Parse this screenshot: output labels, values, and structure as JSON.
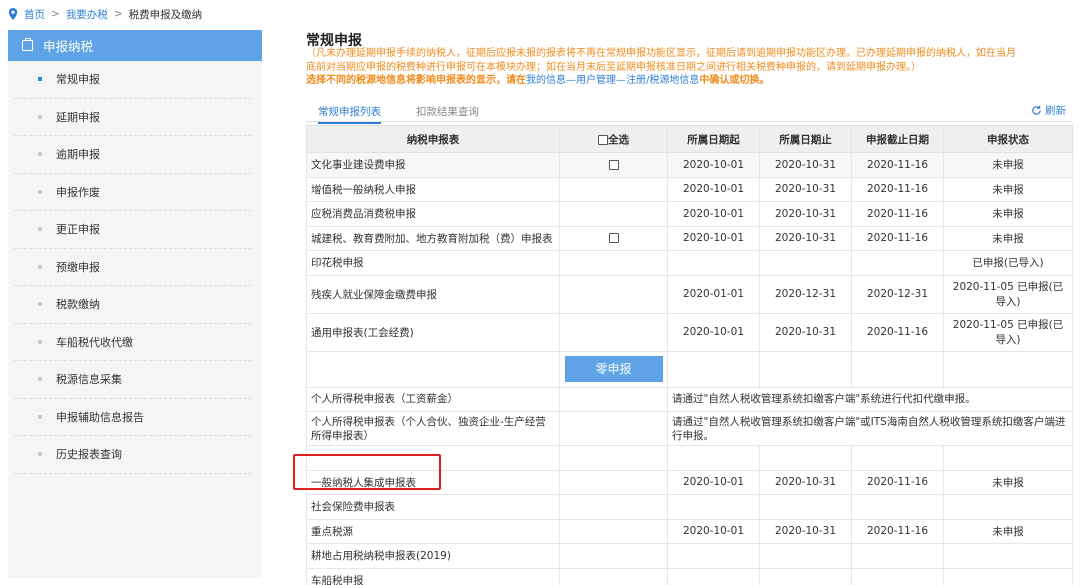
{
  "breadcrumb": {
    "home": "首页",
    "sep": ">",
    "l2": "我要办税",
    "current": "税费申报及缴纳"
  },
  "sidebar": {
    "header": "申报纳税",
    "items": [
      {
        "label": "常规申报",
        "active": true
      },
      {
        "label": "延期申报"
      },
      {
        "label": "逾期申报"
      },
      {
        "label": "申报作废"
      },
      {
        "label": "更正申报"
      },
      {
        "label": "预缴申报"
      },
      {
        "label": "税款缴纳"
      },
      {
        "label": "车船税代收代缴"
      },
      {
        "label": "税源信息采集"
      },
      {
        "label": "申报辅助信息报告"
      },
      {
        "label": "历史报表查询"
      }
    ]
  },
  "main": {
    "title": "常规申报",
    "notice_line1": "（凡未办理延期申报手续的纳税人，征期后应报未报的报表将不再在常规申报功能区显示，征期后请到逾期申报功能区办理。已办理延期申报的纳税人，如在当月",
    "notice_line2": "底前对当期应申报的税费种进行申报可在本模块办理；如在当月末后至延期申报核准日期之间进行相关税费种申报的，请到延期申报办理。）",
    "notice3_a": "选择不同的税源地信息将影响申报表的显示，请在",
    "notice3_link": "我的信息—用户管理—注册/税源地信息",
    "notice3_b": "中确认或切换。",
    "tabs": [
      "常规申报列表",
      "扣款结果查询"
    ],
    "refresh": "刷新"
  },
  "table": {
    "headers": [
      "纳税申报表",
      "全选",
      "所属日期起",
      "所属日期止",
      "申报截止日期",
      "申报状态"
    ],
    "rows": [
      {
        "name": "文化事业建设费申报",
        "cb": true,
        "start": "2020-10-01",
        "end": "2020-10-31",
        "deadline": "2020-11-16",
        "status": "未申报",
        "gray": true
      },
      {
        "name": "增值税一般纳税人申报",
        "start": "2020-10-01",
        "end": "2020-10-31",
        "deadline": "2020-11-16",
        "status": "未申报"
      },
      {
        "name": "应税消费品消费税申报",
        "start": "2020-10-01",
        "end": "2020-10-31",
        "deadline": "2020-11-16",
        "status": "未申报"
      },
      {
        "name": "城建税、教育费附加、地方教育附加税（费）申报表",
        "cb": true,
        "start": "2020-10-01",
        "end": "2020-10-31",
        "deadline": "2020-11-16",
        "status": "未申报"
      },
      {
        "name": "印花税申报",
        "status": "已申报(已导入)"
      },
      {
        "name": "残疾人就业保障金缴费申报",
        "start": "2020-01-01",
        "end": "2020-12-31",
        "deadline": "2020-12-31",
        "status": "2020-11-05 已申报(已导入)"
      },
      {
        "name": "通用申报表(工会经费)",
        "start": "2020-10-01",
        "end": "2020-10-31",
        "deadline": "2020-11-16",
        "status": "2020-11-05 已申报(已导入)"
      }
    ],
    "zero_button": "零申报",
    "rows2": [
      {
        "name": "个人所得税申报表（工资薪金）",
        "note": "请通过\"自然人税收管理系统扣缴客户端\"系统进行代扣代缴申报。"
      },
      {
        "name": "个人所得税申报表（个人合伙、独资企业-生产经营所得申报表）",
        "note": "请通过\"自然人税收管理系统扣缴客户端\"或ITS海南自然人税收管理系统扣缴客户端进行申报。"
      }
    ],
    "rows3": [
      {
        "name": "一般纳税人集成申报表",
        "start": "2020-10-01",
        "end": "2020-10-31",
        "deadline": "2020-11-16",
        "status": "未申报"
      },
      {
        "name": "社会保险费申报表"
      },
      {
        "name": "重点税源",
        "start": "2020-10-01",
        "end": "2020-10-31",
        "deadline": "2020-11-16",
        "status": "未申报"
      },
      {
        "name": "耕地占用税纳税申报表(2019)"
      },
      {
        "name": "车船税申报"
      }
    ]
  },
  "colors": {
    "accent": "#2f7fd6",
    "sidebar_header": "#5ea3e6",
    "notice": "#f08c1c",
    "highlight": "#e02020"
  }
}
